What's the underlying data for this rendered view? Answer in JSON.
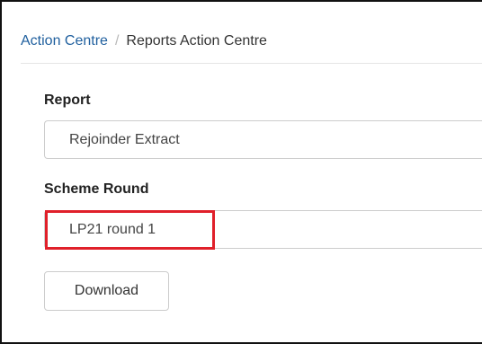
{
  "breadcrumb": {
    "link_label": "Action Centre",
    "separator": "/",
    "current_label": "Reports Action Centre"
  },
  "form": {
    "report": {
      "label": "Report",
      "value": "Rejoinder Extract"
    },
    "scheme_round": {
      "label": "Scheme Round",
      "value": "LP21 round 1"
    },
    "download_label": "Download"
  },
  "colors": {
    "link": "#1f5f9e",
    "highlight": "#e0202a",
    "border": "#cccccc"
  }
}
